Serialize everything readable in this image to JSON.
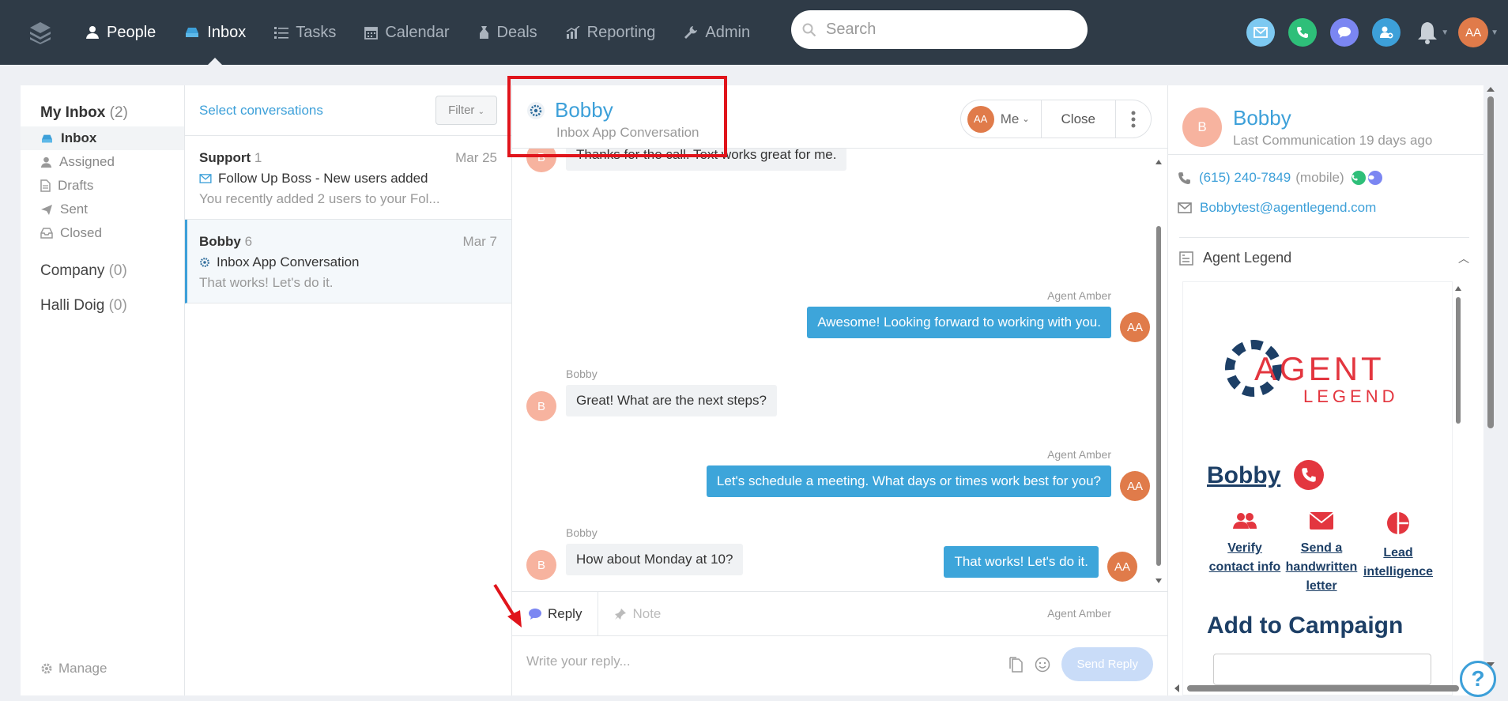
{
  "nav": {
    "items": [
      {
        "label": "People",
        "icon": "person-icon",
        "active": false
      },
      {
        "label": "Inbox",
        "icon": "inbox-icon",
        "active": true
      },
      {
        "label": "Tasks",
        "icon": "list-icon",
        "active": false
      },
      {
        "label": "Calendar",
        "icon": "calendar-icon",
        "active": false
      },
      {
        "label": "Deals",
        "icon": "deals-icon",
        "active": false
      },
      {
        "label": "Reporting",
        "icon": "chart-icon",
        "active": false
      },
      {
        "label": "Admin",
        "icon": "wrench-icon",
        "active": false
      }
    ],
    "search_placeholder": "Search",
    "user_initials": "AA"
  },
  "sidebar": {
    "my_inbox_label": "My Inbox",
    "my_inbox_count": "(2)",
    "items": [
      {
        "label": "Inbox",
        "icon": "inbox-icon"
      },
      {
        "label": "Assigned",
        "icon": "person-icon"
      },
      {
        "label": "Drafts",
        "icon": "document-icon"
      },
      {
        "label": "Sent",
        "icon": "send-icon"
      },
      {
        "label": "Closed",
        "icon": "tray-icon"
      }
    ],
    "company_label": "Company",
    "company_count": "(0)",
    "halli_label": "Halli Doig",
    "halli_count": "(0)",
    "manage_label": "Manage"
  },
  "conversations": {
    "select_label": "Select conversations",
    "filter_label": "Filter",
    "items": [
      {
        "name": "Support",
        "count": "1",
        "date": "Mar 25",
        "subject": "Follow Up Boss - New users added",
        "preview": "You recently added 2 users to your Fol..."
      },
      {
        "name": "Bobby",
        "count": "6",
        "date": "Mar 7",
        "subject": "Inbox App Conversation",
        "preview": "That works! Let's do it."
      }
    ]
  },
  "chat": {
    "title": "Bobby",
    "subtitle": "Inbox App Conversation",
    "assignee_initials": "AA",
    "assignee_label": "Me",
    "close_label": "Close",
    "messages": [
      {
        "text": "Thanks for the call. Text works great for me."
      },
      {
        "sender": "Agent Amber",
        "text": "Awesome! Looking forward to working with you.",
        "initials": "AA"
      },
      {
        "sender": "Bobby",
        "text": "Great! What are the next steps?",
        "initials": "B"
      },
      {
        "sender": "Agent Amber",
        "text": "Let's schedule a meeting. What days or times work best for you?",
        "initials": "AA"
      },
      {
        "sender": "Bobby",
        "text": "How about Monday at 10?",
        "initials": "B"
      },
      {
        "sender": "Agent Amber",
        "text": "That works! Let's do it.",
        "initials": "AA"
      }
    ],
    "first_avatar": "B",
    "reply_tab": "Reply",
    "note_tab": "Note",
    "reply_placeholder": "Write your reply...",
    "send_label": "Send Reply"
  },
  "contact": {
    "initials": "B",
    "name": "Bobby",
    "last_comm": "Last Communication 19 days ago",
    "phone": "(615) 240-7849",
    "phone_type": "(mobile)",
    "email": "Bobbytest@agentlegend.com",
    "section_label": "Agent Legend",
    "widget": {
      "logo_line1": "AGENT",
      "logo_line2": "LEGEND",
      "name_link": "Bobby",
      "actions": [
        {
          "label": "Verify contact info",
          "icon": "people-icon"
        },
        {
          "label": "Send a handwritten letter",
          "icon": "envelope-icon"
        },
        {
          "label": "Lead intelligence",
          "icon": "pie-chart-icon"
        }
      ],
      "add_campaign": "Add to Campaign"
    }
  },
  "help_label": "?",
  "colors": {
    "nav_bg": "#2f3b47",
    "accent": "#3da0d9",
    "highlight_box": "#e0141b",
    "outgoing_bubble": "#3da5da",
    "brand_dark": "#1d3f66",
    "brand_red": "#e3363f"
  }
}
